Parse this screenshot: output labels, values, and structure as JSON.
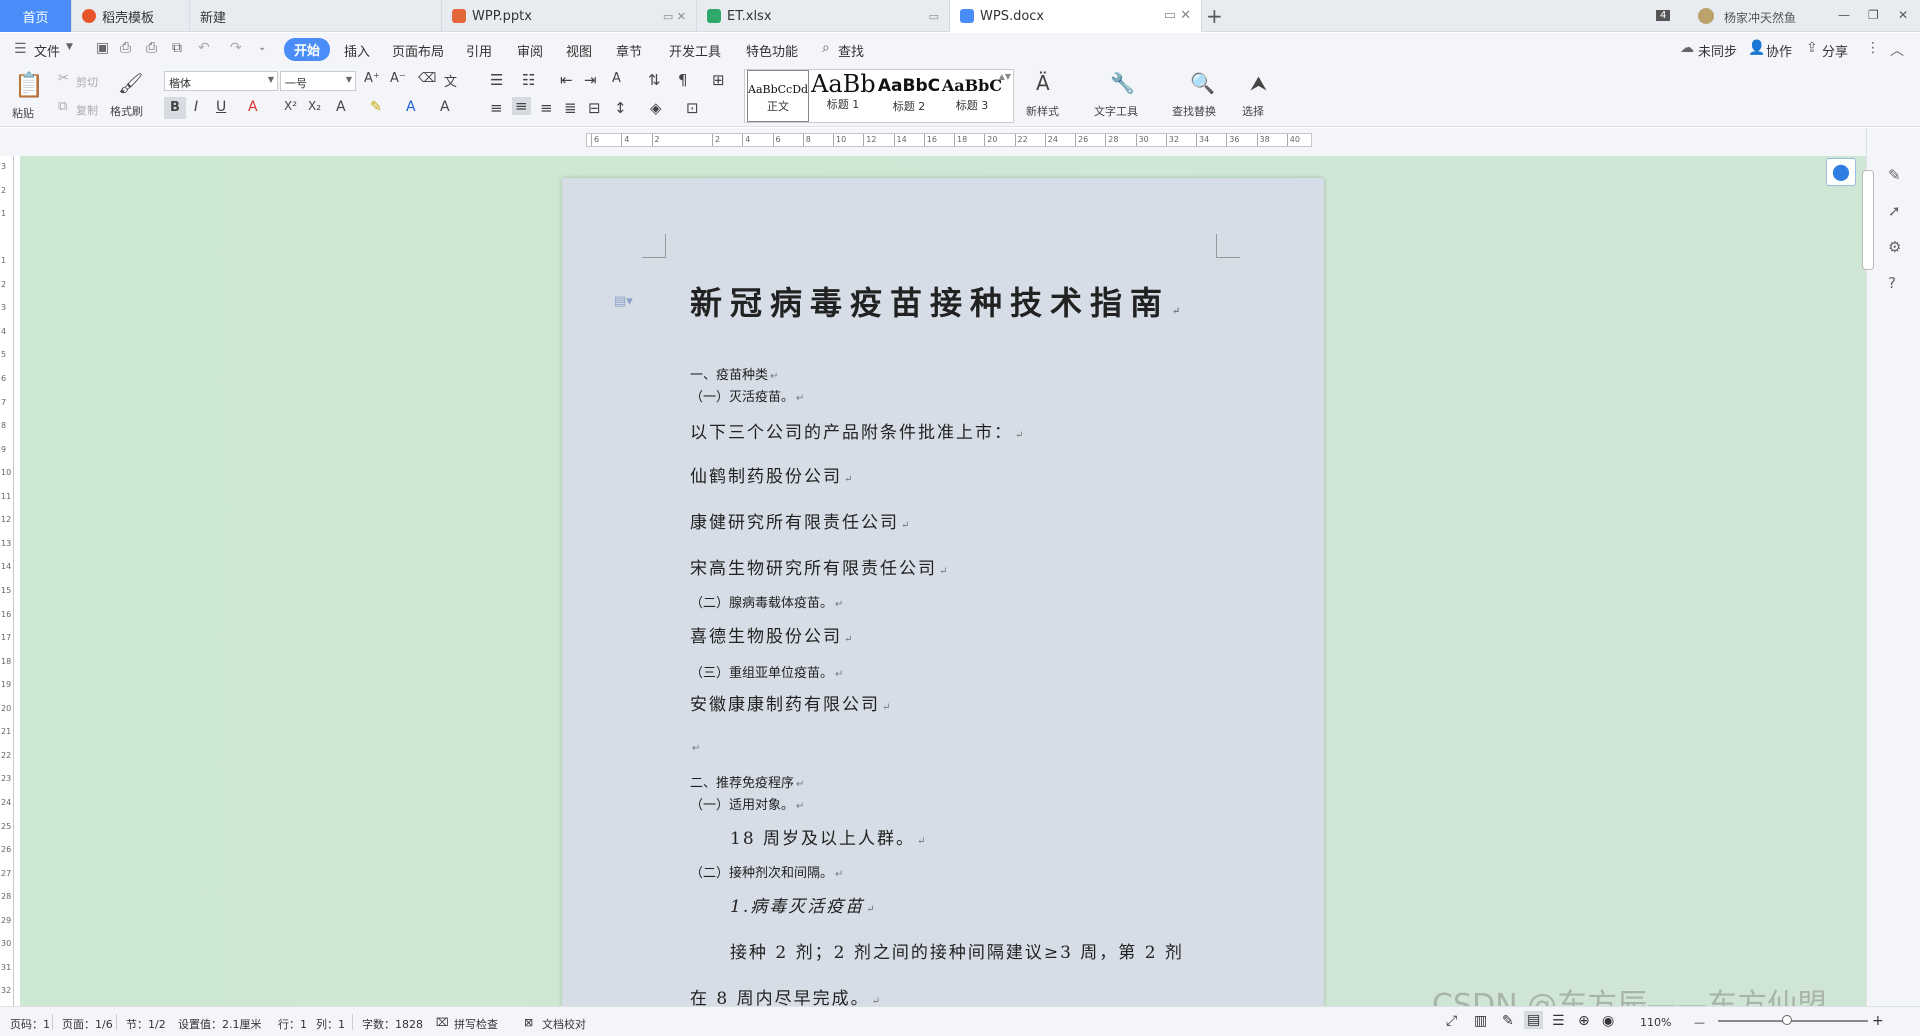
{
  "tabs": {
    "home": "首页",
    "template": "稻壳模板",
    "new": "新建",
    "pptx": "WPP.pptx",
    "xlsx": "ET.xlsx",
    "docx": "WPS.docx",
    "badge": "4",
    "user": "杨家冲天然鱼"
  },
  "menu": {
    "file": "文件",
    "items": [
      "开始",
      "插入",
      "页面布局",
      "引用",
      "审阅",
      "视图",
      "章节",
      "开发工具",
      "特色功能"
    ],
    "search": "查找",
    "unsynced": "未同步",
    "collab": "协作",
    "share": "分享"
  },
  "toolbar": {
    "paste": "粘贴",
    "cut": "剪切",
    "copy": "复制",
    "format_painter": "格式刷",
    "font": "楷体",
    "size": "一号",
    "styles": [
      {
        "preview": "AaBbCcDd",
        "name": "正文"
      },
      {
        "preview": "AaBb",
        "name": "标题 1"
      },
      {
        "preview": "AaBbC",
        "name": "标题 2"
      },
      {
        "preview": "AaBbC",
        "name": "标题 3"
      }
    ],
    "new_style": "新样式",
    "text_tools": "文字工具",
    "find_replace": "查找替换",
    "select": "选择"
  },
  "ruler": {
    "h_ticks": [
      "6",
      "4",
      "2",
      "",
      "2",
      "4",
      "6",
      "8",
      "10",
      "12",
      "14",
      "16",
      "18",
      "20",
      "22",
      "24",
      "26",
      "28",
      "30",
      "32",
      "34",
      "36",
      "38",
      "40"
    ],
    "v_ticks": [
      "3",
      "2",
      "1",
      "",
      "1",
      "2",
      "3",
      "4",
      "5",
      "6",
      "7",
      "8",
      "9",
      "10",
      "11",
      "12",
      "13",
      "14",
      "15",
      "16",
      "17",
      "18",
      "19",
      "20",
      "21",
      "22",
      "23",
      "24",
      "25",
      "26",
      "27",
      "28",
      "29",
      "30",
      "31",
      "32"
    ]
  },
  "document": {
    "title": "新冠病毒疫苗接种技术指南",
    "s1": "一、疫苗种类",
    "s1a": "（一）灭活疫苗。",
    "p1": "以下三个公司的产品附条件批准上市：",
    "c1": "仙鹤制药股份公司",
    "c2": "康健研究所有限责任公司",
    "c3": "宋高生物研究所有限责任公司",
    "s1b": "（二）腺病毒载体疫苗。",
    "c4": "喜德生物股份公司",
    "s1c": "（三）重组亚单位疫苗。",
    "c5": "安徽康康制药有限公司",
    "s2": "二、推荐免疫程序",
    "s2a": "（一）适用对象。",
    "p2": "18 周岁及以上人群。",
    "s2b": "（二）接种剂次和间隔。",
    "p3": "1.病毒灭活疫苗",
    "p4": "接种 2 剂；2 剂之间的接种间隔建议≥3 周，第 2 剂",
    "p5": "在 8 周内尽早完成。"
  },
  "status": {
    "page": "页码：1",
    "pages": "页面：1/6",
    "section": "节：1/2",
    "setting": "设置值：2.1厘米",
    "row": "行：1",
    "col": "列：1",
    "words": "字数：1828",
    "spell": "拼写检查",
    "proof": "文档校对",
    "zoom": "110%",
    "minus": "—",
    "plus": "+"
  },
  "watermark": "CSDN @东方辰——东方仙盟"
}
